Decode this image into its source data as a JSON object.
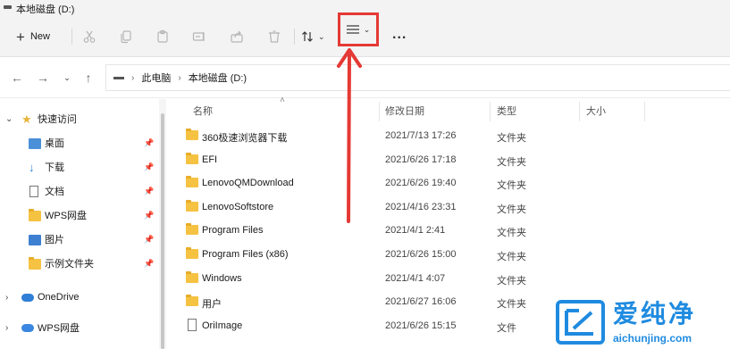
{
  "window": {
    "title": "本地磁盘 (D:)"
  },
  "toolbar": {
    "new_label": "New",
    "buttons": [
      "cut-icon",
      "copy-icon",
      "paste-icon",
      "rename-icon",
      "share-icon",
      "delete-icon",
      "sort-icon",
      "view-icon",
      "more-icon"
    ],
    "more_label": "..."
  },
  "address": {
    "crumbs": [
      "此电脑",
      "本地磁盘 (D:)"
    ]
  },
  "sidebar": {
    "items": [
      {
        "label": "快速访问",
        "icon": "star-icon"
      },
      {
        "label": "桌面",
        "icon": "desktop-icon"
      },
      {
        "label": "下载",
        "icon": "download-icon"
      },
      {
        "label": "文档",
        "icon": "document-icon"
      },
      {
        "label": "WPS网盘",
        "icon": "folder-icon"
      },
      {
        "label": "图片",
        "icon": "picture-icon"
      },
      {
        "label": "示例文件夹",
        "icon": "folder-icon"
      },
      {
        "label": "OneDrive",
        "icon": "cloud-icon"
      },
      {
        "label": "WPS网盘",
        "icon": "cloud-icon"
      }
    ]
  },
  "columns": {
    "name": "名称",
    "date": "修改日期",
    "type": "类型",
    "size": "大小"
  },
  "files": [
    {
      "name": "360极速浏览器下载",
      "date": "2021/7/13 17:26",
      "type": "文件夹"
    },
    {
      "name": "EFI",
      "date": "2021/6/26 17:18",
      "type": "文件夹"
    },
    {
      "name": "LenovoQMDownload",
      "date": "2021/6/26 19:40",
      "type": "文件夹"
    },
    {
      "name": "LenovoSoftstore",
      "date": "2021/4/16 23:31",
      "type": "文件夹"
    },
    {
      "name": "Program Files",
      "date": "2021/4/1 2:41",
      "type": "文件夹"
    },
    {
      "name": "Program Files (x86)",
      "date": "2021/6/26 15:00",
      "type": "文件夹"
    },
    {
      "name": "Windows",
      "date": "2021/4/1 4:07",
      "type": "文件夹"
    },
    {
      "name": "用户",
      "date": "2021/6/27 16:06",
      "type": "文件夹"
    },
    {
      "name": "OriImage",
      "date": "2021/6/26 15:15",
      "type": "文件"
    }
  ],
  "watermark": {
    "title": "爱纯净",
    "url": "aichunjing.com"
  },
  "colors": {
    "highlight": "#e53935",
    "folder": "#f5c242",
    "brand": "#1f8be0"
  }
}
